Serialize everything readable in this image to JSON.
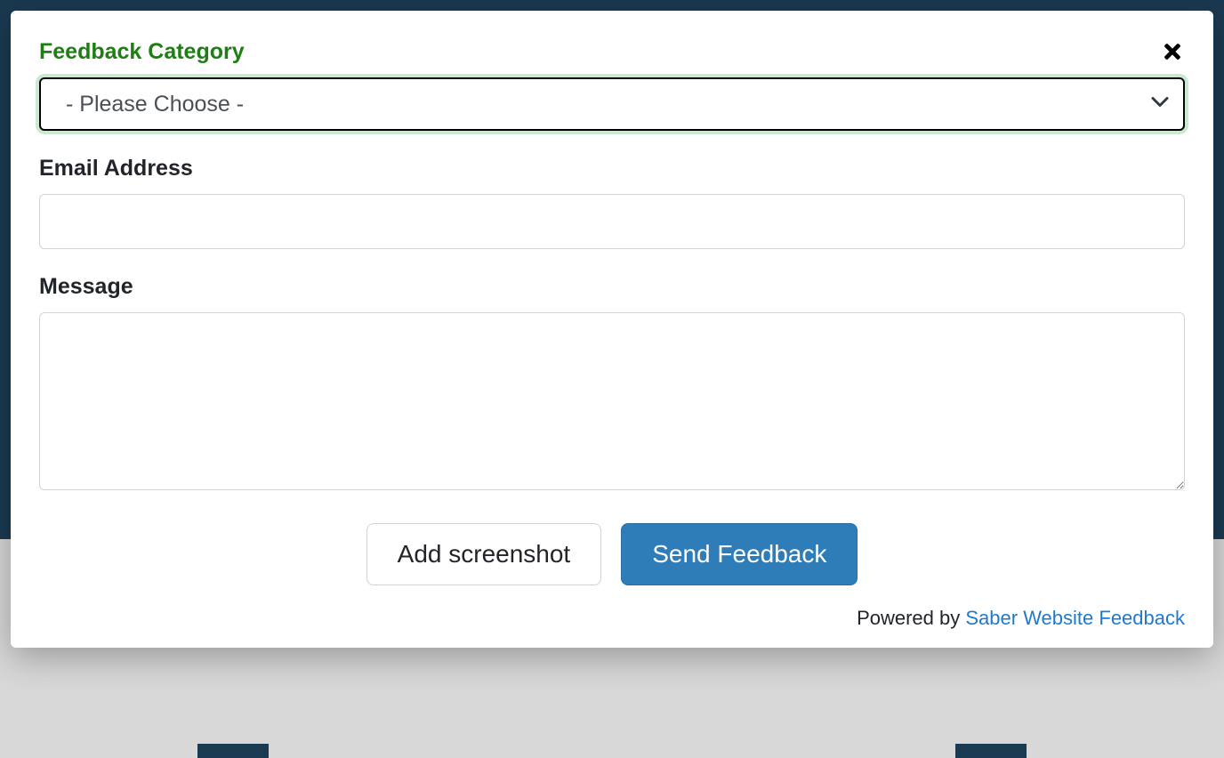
{
  "form": {
    "category_label": "Feedback Category",
    "category_selected": "- Please Choose -",
    "email_label": "Email Address",
    "email_value": "",
    "message_label": "Message",
    "message_value": ""
  },
  "buttons": {
    "add_screenshot": "Add screenshot",
    "send_feedback": "Send Feedback"
  },
  "footer": {
    "powered_by": "Powered by ",
    "link_text": "Saber Website Feedback"
  },
  "colors": {
    "success_green": "#1e7e14",
    "primary_blue": "#2f7db8",
    "link_blue": "#1f7acc",
    "bg_dark": "#1a3a52"
  }
}
